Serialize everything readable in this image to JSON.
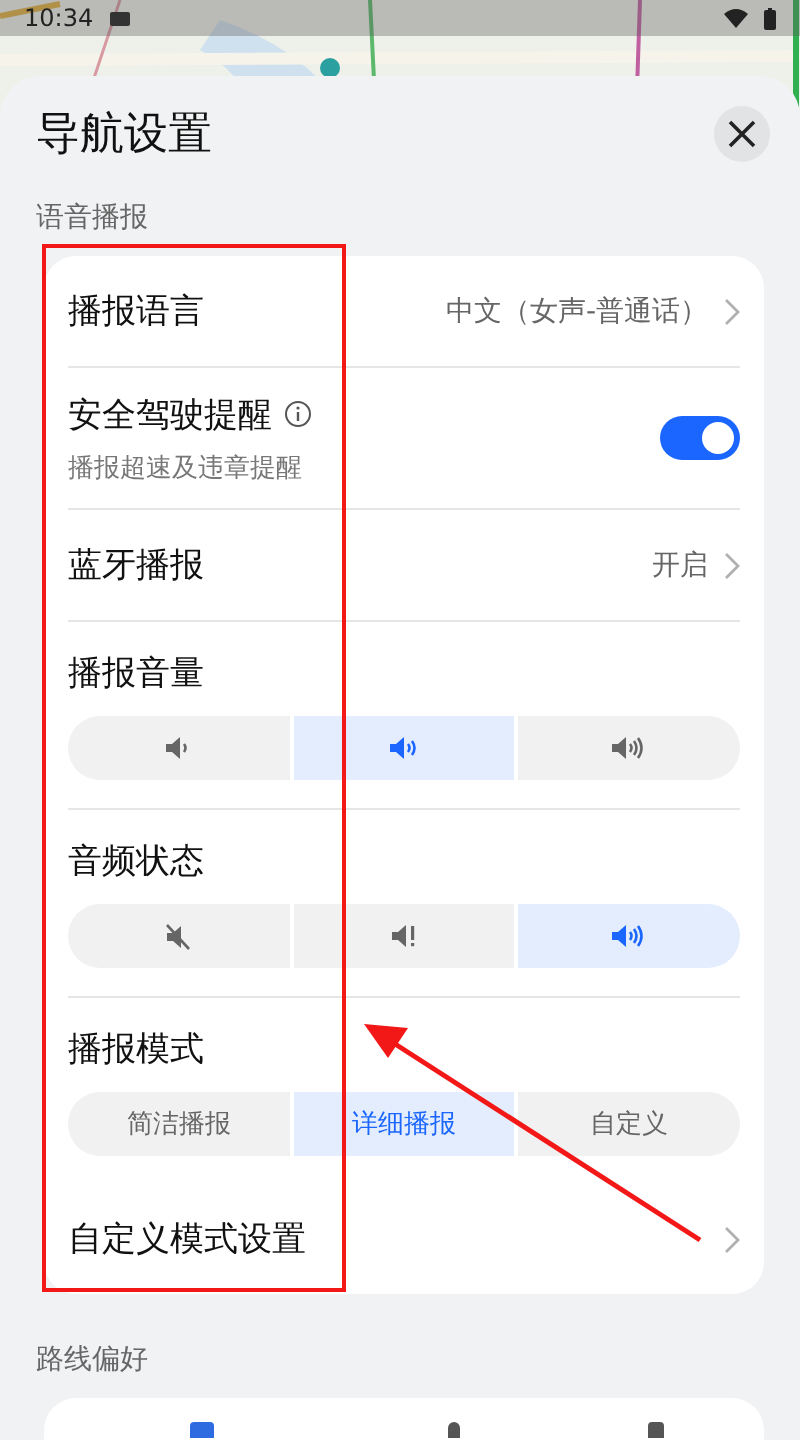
{
  "status_bar": {
    "time": "10:34"
  },
  "sheet": {
    "title": "导航设置"
  },
  "sections": [
    {
      "title": "语音播报",
      "rows": [
        {
          "kind": "link",
          "label": "播报语言",
          "value": "中文（女声-普通话）"
        },
        {
          "kind": "toggle",
          "label": "安全驾驶提醒",
          "info": true,
          "subtitle": "播报超速及违章提醒",
          "on": true
        },
        {
          "kind": "link",
          "label": "蓝牙播报",
          "value": "开启"
        },
        {
          "kind": "segments",
          "label": "播报音量",
          "options": [
            {
              "kind": "low",
              "selected": false
            },
            {
              "kind": "mid",
              "selected": true
            },
            {
              "kind": "high",
              "selected": false
            }
          ]
        },
        {
          "kind": "segments",
          "label": "音频状态",
          "options": [
            {
              "kind": "muted",
              "selected": false
            },
            {
              "kind": "alert",
              "selected": false
            },
            {
              "kind": "high",
              "selected": true
            }
          ]
        },
        {
          "kind": "segments",
          "label": "播报模式",
          "options": [
            {
              "kind": "text",
              "text": "简洁播报",
              "selected": false
            },
            {
              "kind": "text",
              "text": "详细播报",
              "selected": true
            },
            {
              "kind": "text",
              "text": "自定义",
              "selected": false
            }
          ]
        },
        {
          "kind": "link",
          "label": "自定义模式设置"
        }
      ]
    },
    {
      "title": "路线偏好"
    }
  ]
}
